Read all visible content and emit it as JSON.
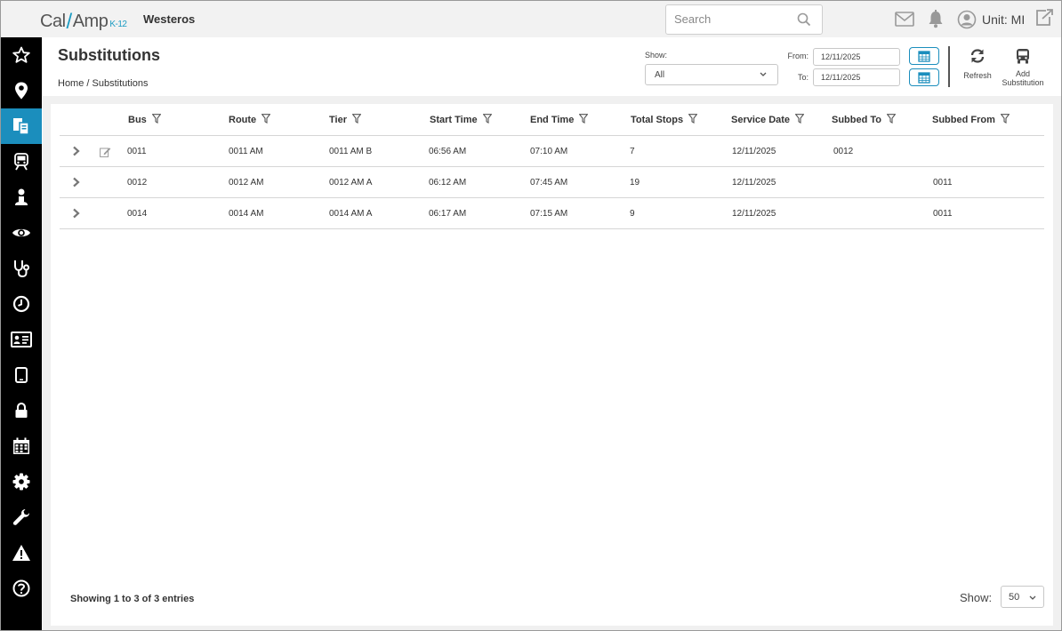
{
  "brand": {
    "name_left": "Cal",
    "slash": "/",
    "name_right": "Amp",
    "suffix": "K-12"
  },
  "org_name": "Westeros",
  "search": {
    "placeholder": "Search"
  },
  "user": {
    "unit_label": "Unit: MI"
  },
  "sidebar": {
    "items": [
      {
        "icon": "star-icon"
      },
      {
        "icon": "map-pin-icon"
      },
      {
        "icon": "substitutions-icon",
        "active": true
      },
      {
        "icon": "bus-icon"
      },
      {
        "icon": "student-icon"
      },
      {
        "icon": "eye-icon"
      },
      {
        "icon": "stethoscope-icon"
      },
      {
        "icon": "clock-icon"
      },
      {
        "icon": "id-card-icon"
      },
      {
        "icon": "tablet-icon"
      },
      {
        "icon": "lock-icon"
      },
      {
        "icon": "calendar-icon"
      },
      {
        "icon": "gear-icon"
      },
      {
        "icon": "wrench-icon"
      },
      {
        "icon": "warning-icon"
      },
      {
        "icon": "help-icon"
      }
    ]
  },
  "page": {
    "title": "Substitutions",
    "breadcrumb": "Home / Substitutions"
  },
  "filters": {
    "show_label": "Show:",
    "show_value": "All",
    "from_label": "From:",
    "from_value": "12/11/2025",
    "to_label": "To:",
    "to_value": "12/11/2025"
  },
  "actions": {
    "refresh_label": "Refresh",
    "add_line1": "Add",
    "add_line2": "Substitution"
  },
  "table": {
    "columns": [
      "Bus",
      "Route",
      "Tier",
      "Start Time",
      "End Time",
      "Total Stops",
      "Service Date",
      "Subbed To",
      "Subbed From"
    ],
    "rows": [
      {
        "bus": "0011",
        "route": "0011 AM",
        "tier": "0011 AM  B",
        "start": "06:56 AM",
        "end": "07:10 AM",
        "stops": "7",
        "date": "12/11/2025",
        "to": "0012",
        "from": "",
        "editable": true
      },
      {
        "bus": "0012",
        "route": "0012 AM",
        "tier": "0012 AM  A",
        "start": "06:12 AM",
        "end": "07:45 AM",
        "stops": "19",
        "date": "12/11/2025",
        "to": "",
        "from": "0011",
        "editable": false
      },
      {
        "bus": "0014",
        "route": "0014 AM",
        "tier": "0014 AM  A",
        "start": "06:17 AM",
        "end": "07:15 AM",
        "stops": "9",
        "date": "12/11/2025",
        "to": "",
        "from": "0011",
        "editable": false
      }
    ]
  },
  "footer": {
    "info": "Showing 1 to 3 of 3 entries",
    "page_size_label": "Show:",
    "page_size_value": "50"
  },
  "colors": {
    "accent": "#1b8ebd",
    "sidebar": "#000000",
    "topbar": "#f2f2f2"
  }
}
